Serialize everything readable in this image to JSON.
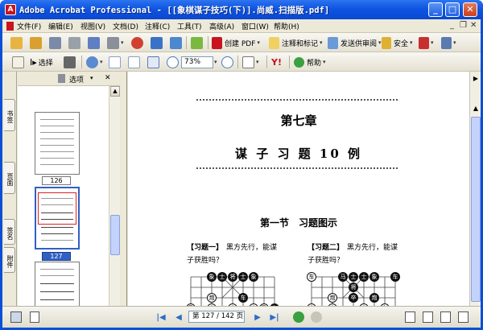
{
  "window": {
    "title": "Adobe Acrobat Professional - [[象棋谋子技巧(下)].尚威.扫描版.pdf]",
    "app_icon_glyph": "A",
    "minimize": "_",
    "maximize": "□",
    "close": "✕"
  },
  "menubar": {
    "items": [
      "文件(F)",
      "编辑(E)",
      "视图(V)",
      "文档(D)",
      "注释(C)",
      "工具(T)",
      "高级(A)",
      "窗口(W)",
      "帮助(H)"
    ]
  },
  "toolbar1": {
    "create_pdf": "创建 PDF",
    "comment_markup": "注释和标记",
    "send_review": "发送供审阅",
    "secure": "安全"
  },
  "toolbar2": {
    "select": "选择",
    "zoom_value": "73%",
    "help": "帮助",
    "yahoo": "Y!"
  },
  "left_tabs": [
    "书签",
    "页面",
    "签名",
    "附件"
  ],
  "pages_panel": {
    "options": "选项",
    "pages": [
      {
        "label": "126",
        "selected": false
      },
      {
        "label": "127",
        "selected": true
      }
    ]
  },
  "document": {
    "chapter": "第七章",
    "chapter_subtitle": "谋 子 习 题 10 例",
    "section": "第一节　习题图示",
    "problem1_title": "【习题一】",
    "problem1_text1": "黑方先行，能谋",
    "problem1_text2": "子获胜吗？",
    "problem2_title": "【习题二】",
    "problem2_text1": "黑方先行，能谋",
    "problem2_text2": "子获胜吗？",
    "board1_pieces": [
      "象",
      "士",
      "将",
      "士",
      "象",
      "炮",
      "车",
      "马",
      "卒",
      "卒",
      "卒",
      "马",
      "车",
      "兵"
    ],
    "board2_pieces": [
      "车",
      "马",
      "士",
      "象",
      "车",
      "士",
      "将",
      "炮",
      "卒",
      "炮",
      "卒",
      "卒",
      "卒",
      "车",
      "马"
    ]
  },
  "statusbar": {
    "page_indicator": "第 127 / 142 页"
  },
  "colors": {
    "titlebar": "#0f55e2",
    "selection": "#3160c4",
    "chrome": "#ece9d8"
  }
}
